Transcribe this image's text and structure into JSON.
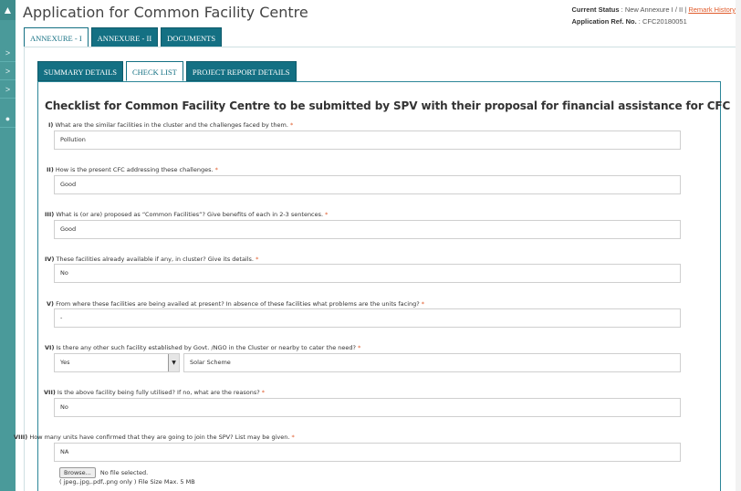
{
  "sidebar": {
    "logo_glyph": "▲",
    "items": [
      ">",
      ">",
      ">",
      "●"
    ]
  },
  "header": {
    "title": "Application for Common Facility Centre",
    "status_label": "Current Status",
    "status_value": " : New Annexure I / II |",
    "remark_link": "Remark History",
    "ref_label": "Application Ref. No.",
    "ref_value": " : CFC20180051"
  },
  "main_tabs": [
    "ANNEXURE - I",
    "ANNEXURE - II",
    "DOCUMENTS"
  ],
  "sub_tabs": [
    "SUMMARY DETAILS",
    "CHECK LIST",
    "PROJECT REPORT DETAILS"
  ],
  "heading": "Checklist for Common Facility Centre to be submitted by SPV with their proposal for financial assistance for CFC",
  "questions": [
    {
      "num": "I)",
      "text": "What are the similar facilities in the cluster and the challenges faced by them.",
      "value": "Pollution"
    },
    {
      "num": "II)",
      "text": "How is the present CFC addressing these challenges.",
      "value": "Good"
    },
    {
      "num": "III)",
      "text": "What is (or are) proposed as “Common Facilities”? Give benefits of each in 2-3 sentences.",
      "value": "Good"
    },
    {
      "num": "IV)",
      "text": "These facilities already available if any, in cluster? Give its details.",
      "value": "No"
    },
    {
      "num": "V)",
      "text": "From where these facilities are being availed at present? In absence of these facilities what problems are the units facing?",
      "value": "-"
    },
    {
      "num": "VI)",
      "text": "Is there any other such facility established by Govt. /NGO in the Cluster or nearby to cater the need?",
      "select_value": "Yes",
      "value": "Solar Scheme"
    },
    {
      "num": "VII)",
      "text": "Is the above facility being fully utilised? If no, what are the reasons?",
      "value": "No"
    },
    {
      "num": "VIII)",
      "text": "How many units have confirmed that they are going to join the SPV? List may be given.",
      "value": "NA"
    }
  ],
  "required_mark": "*",
  "upload": {
    "button": "Browse...",
    "status": "No file selected.",
    "hint": "( jpeg,.jpg,.pdf,.png only ) File Size Max. 5 MB"
  }
}
